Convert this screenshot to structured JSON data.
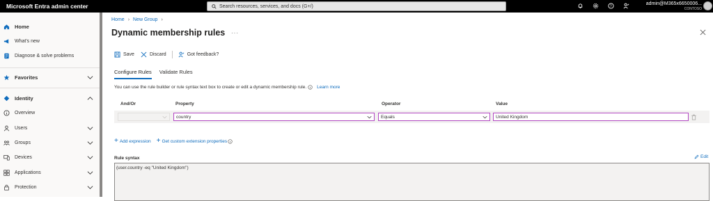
{
  "app": {
    "title": "Microsoft Entra admin center"
  },
  "search": {
    "placeholder": "Search resources, services, and docs (G+/)"
  },
  "account": {
    "user": "admin@M365x6650006...",
    "tenant": "CONTOSO"
  },
  "sidebar": {
    "items": [
      {
        "label": "Home",
        "icon": "home-icon"
      },
      {
        "label": "What's new",
        "icon": "megaphone-icon"
      },
      {
        "label": "Diagnose & solve problems",
        "icon": "diagnose-icon"
      },
      {
        "label": "Favorites",
        "icon": "star-icon"
      },
      {
        "label": "Identity",
        "icon": "identity-icon"
      },
      {
        "label": "Overview",
        "icon": "info-icon"
      },
      {
        "label": "Users",
        "icon": "user-icon"
      },
      {
        "label": "Groups",
        "icon": "groups-icon"
      },
      {
        "label": "Devices",
        "icon": "devices-icon"
      },
      {
        "label": "Applications",
        "icon": "applications-icon"
      },
      {
        "label": "Protection",
        "icon": "lock-icon"
      }
    ]
  },
  "breadcrumb": {
    "home": "Home",
    "group": "New Group"
  },
  "page": {
    "title": "Dynamic membership rules",
    "more": "···"
  },
  "toolbar": {
    "save": "Save",
    "discard": "Discard",
    "feedback": "Got feedback?"
  },
  "tabs": {
    "configure": "Configure Rules",
    "validate": "Validate Rules"
  },
  "description": {
    "text": "You can use the rule builder or rule syntax text box to create or edit a dynamic membership rule.",
    "learn_more": "Learn more"
  },
  "rules_table": {
    "headers": {
      "and_or": "And/Or",
      "property": "Property",
      "operator": "Operator",
      "value": "Value"
    },
    "row": {
      "and_or": "",
      "property": "country",
      "operator": "Equals",
      "value": "United Kingdom"
    }
  },
  "links": {
    "add_expression": "Add expression",
    "custom_extension": "Get custom extension properties"
  },
  "rule_syntax": {
    "label": "Rule syntax",
    "edit": "Edit",
    "value": "(user.country -eq \"United Kingdom\")"
  },
  "colors": {
    "accent": "#0f6cbd",
    "focus_border": "#b146c2",
    "topbar": "#000000"
  }
}
